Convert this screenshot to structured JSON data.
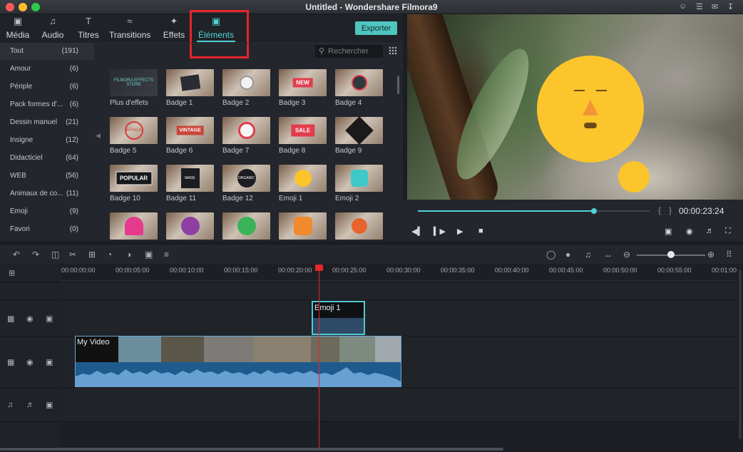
{
  "window": {
    "title": "Untitled - Wondershare Filmora9"
  },
  "tabs": [
    {
      "label": "Média",
      "icon": "folder-icon"
    },
    {
      "label": "Audio",
      "icon": "music-note-icon"
    },
    {
      "label": "Titres",
      "icon": "text-icon"
    },
    {
      "label": "Transitions",
      "icon": "transition-icon"
    },
    {
      "label": "Effets",
      "icon": "effects-icon"
    },
    {
      "label": "Éléments",
      "icon": "image-icon"
    }
  ],
  "active_tab": "Éléments",
  "export_label": "Exporter",
  "search": {
    "placeholder": "Rechercher"
  },
  "categories": [
    {
      "name": "Tout",
      "count": "(191)"
    },
    {
      "name": "Amour",
      "count": "(6)"
    },
    {
      "name": "Périple",
      "count": "(6)"
    },
    {
      "name": "Pack formes d'...",
      "count": "(6)"
    },
    {
      "name": "Dessin manuel",
      "count": "(21)"
    },
    {
      "name": "Insigne",
      "count": "(12)"
    },
    {
      "name": "Didacticiel",
      "count": "(64)"
    },
    {
      "name": "WEB",
      "count": "(56)"
    },
    {
      "name": "Animaux de co...",
      "count": "(11)"
    },
    {
      "name": "Emoji",
      "count": "(9)"
    },
    {
      "name": "Favori",
      "count": "(0)"
    }
  ],
  "elements": [
    {
      "label": "Plus d'effets"
    },
    {
      "label": "Badge 1"
    },
    {
      "label": "Badge 2"
    },
    {
      "label": "Badge 3"
    },
    {
      "label": "Badge 4"
    },
    {
      "label": "Badge 5"
    },
    {
      "label": "Badge 6"
    },
    {
      "label": "Badge 7"
    },
    {
      "label": "Badge 8"
    },
    {
      "label": "Badge 9"
    },
    {
      "label": "Badge 10"
    },
    {
      "label": "Badge 11"
    },
    {
      "label": "Badge 12"
    },
    {
      "label": "Emoji 1"
    },
    {
      "label": "Emoji 2"
    },
    {
      "label": ""
    },
    {
      "label": ""
    },
    {
      "label": ""
    },
    {
      "label": ""
    },
    {
      "label": ""
    }
  ],
  "thumb_glyphs": {
    "more_effects": "FILMORA EFFECTS STORE",
    "badge3": "NEW",
    "badge5": "AFRICA",
    "badge6": "VINTAGE",
    "badge8": "SALE",
    "badge10": "POPULAR",
    "badge11": "MADE FRESH",
    "badge12": "ORGANIC"
  },
  "player": {
    "timecode": "00:00:23:24",
    "progress": 0.76
  },
  "ruler_labels": [
    "00:00:00:00",
    "00:00:05:00",
    "00:00:10:00",
    "00:00:15:00",
    "00:00:20:00",
    "00:00:25:00",
    "00:00:30:00",
    "00:00:35:00",
    "00:00:40:00",
    "00:00:45:00",
    "00:00:50:00",
    "00:00:55:00",
    "00:01:00"
  ],
  "clips": {
    "element_clip": "Emoji 1",
    "video_clip": "My Video"
  },
  "zoom": {
    "level": 0.5
  },
  "colors": {
    "accent": "#4fd1d9",
    "highlight": "#e3262c",
    "playhead": "#e3262c",
    "export": "#4fc6c0"
  }
}
